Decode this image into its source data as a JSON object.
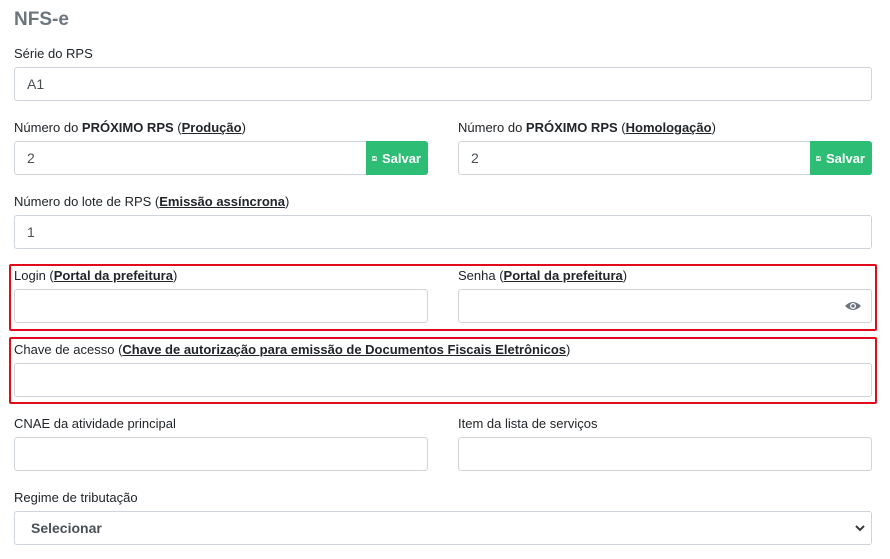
{
  "page": {
    "title": "NFS-e"
  },
  "serie": {
    "label": "Série do RPS",
    "value": "A1"
  },
  "proximo_producao": {
    "label_prefix": "Número do ",
    "label_bold": "PRÓXIMO RPS",
    "label_paren_open": " (",
    "label_link": "Produção",
    "label_paren_close": ")",
    "value": "2",
    "button_label": "Salvar",
    "button_icon": "save-icon"
  },
  "proximo_homologacao": {
    "label_prefix": "Número do ",
    "label_bold": "PRÓXIMO RPS",
    "label_paren_open": " (",
    "label_link": "Homologação",
    "label_paren_close": ")",
    "value": "2",
    "button_label": "Salvar",
    "button_icon": "save-icon"
  },
  "lote": {
    "label_prefix": "Número do lote de RPS (",
    "label_link": "Emissão assíncrona",
    "label_paren_close": ")",
    "value": "1"
  },
  "login": {
    "label_prefix": "Login (",
    "label_link": "Portal da prefeitura",
    "label_paren_close": ")",
    "value": ""
  },
  "senha": {
    "label_prefix": "Senha (",
    "label_link": "Portal da prefeitura",
    "label_paren_close": ")",
    "value": "",
    "icon": "eye-icon"
  },
  "chave": {
    "label_prefix": "Chave de acesso (",
    "label_link": "Chave de autorização para emissão de Documentos Fiscais Eletrônicos",
    "label_paren_close": ")",
    "value": ""
  },
  "cnae": {
    "label": "CNAE da atividade principal",
    "value": ""
  },
  "item_lista": {
    "label": "Item da lista de serviços",
    "value": ""
  },
  "regime": {
    "label": "Regime de tributação",
    "selected": "Selecionar"
  },
  "colors": {
    "save_button": "#2dbd74",
    "highlight_border": "#e00c1b",
    "title": "#6c757d"
  }
}
